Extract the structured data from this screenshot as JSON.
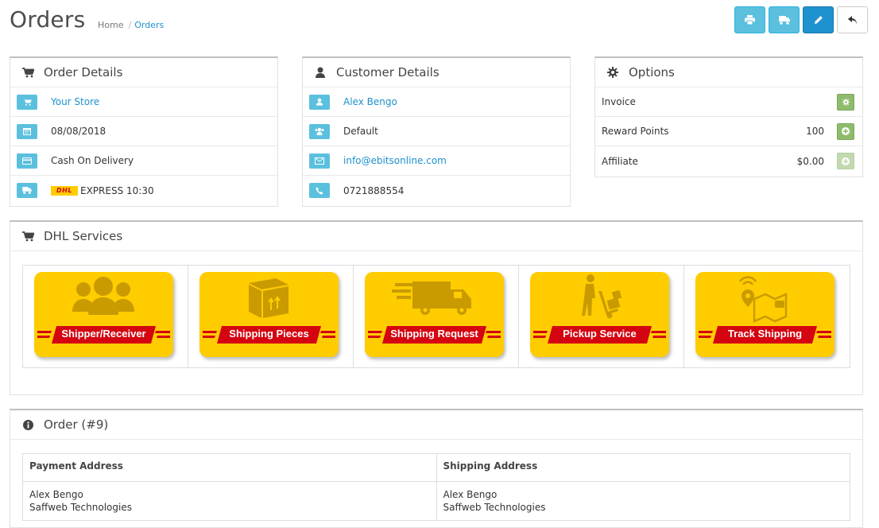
{
  "header": {
    "title": "Orders",
    "breadcrumb": [
      {
        "label": "Home"
      },
      {
        "label": "Orders"
      }
    ],
    "actions": [
      {
        "icon": "print-icon"
      },
      {
        "icon": "truck-icon"
      },
      {
        "icon": "pencil-icon"
      },
      {
        "icon": "reply-icon"
      }
    ]
  },
  "order_details": {
    "title": "Order Details",
    "store": "Your Store",
    "date": "08/08/2018",
    "payment": "Cash On Delivery",
    "shipping": "EXPRESS 10:30",
    "shipping_logo": "DHL"
  },
  "customer_details": {
    "title": "Customer Details",
    "name": "Alex Bengo",
    "group": "Default",
    "email": "info@ebitsonline.com",
    "phone": "0721888554"
  },
  "options": {
    "title": "Options",
    "invoice_label": "Invoice",
    "reward_label": "Reward Points",
    "reward_value": "100",
    "affiliate_label": "Affiliate",
    "affiliate_value": "$0.00"
  },
  "dhl_services": {
    "title": "DHL Services",
    "items": [
      {
        "label": "Shipper/Receiver",
        "icon": "people-icon"
      },
      {
        "label": "Shipping Pieces",
        "icon": "box-icon"
      },
      {
        "label": "Shipping Request",
        "icon": "delivery-truck-icon"
      },
      {
        "label": "Pickup Service",
        "icon": "hand-trolley-icon"
      },
      {
        "label": "Track Shipping",
        "icon": "map-pin-icon"
      }
    ],
    "colors": {
      "yellow": "#ffcc00",
      "red": "#d40511",
      "art": "#c99b00"
    }
  },
  "order": {
    "title": "Order (#9)",
    "payment_header": "Payment Address",
    "shipping_header": "Shipping Address",
    "payment_lines": [
      "Alex Bengo",
      "Saffweb Technologies"
    ],
    "shipping_lines": [
      "Alex Bengo",
      "Saffweb Technologies"
    ]
  }
}
